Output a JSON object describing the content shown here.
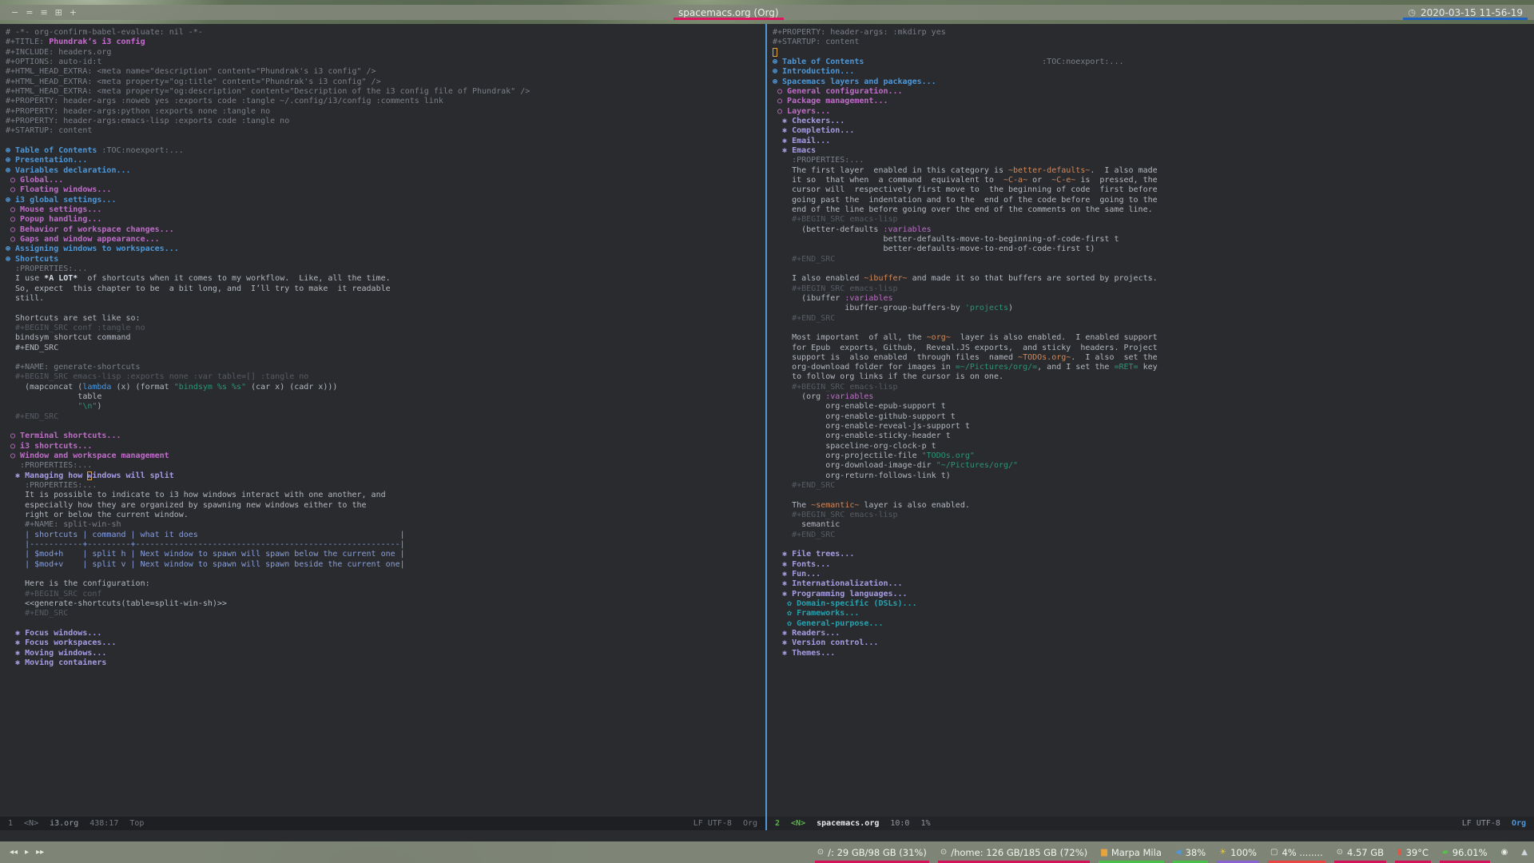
{
  "colors": {
    "background": "#292b2e",
    "divider_blue": "#4f97d7",
    "title_underline": "#dc1560",
    "clock_underline": "#1d62c4",
    "heading1": "#4f97d7",
    "heading2": "#bc6ec5",
    "heading3": "#a79ce0",
    "heading4": "#2aa1ae",
    "string_green": "#2d9574",
    "inline_code_orange": "#d3885a",
    "cursor_outline": "#e2a33c"
  },
  "top_bar": {
    "window_buttons": [
      {
        "name": "layout-dash-icon",
        "glyph": "−"
      },
      {
        "name": "layout-stacked-icon",
        "glyph": "="
      },
      {
        "name": "layout-tabbed-icon",
        "glyph": "≡"
      },
      {
        "name": "layout-grid-icon",
        "glyph": "⊞"
      },
      {
        "name": "new-workspace-icon",
        "glyph": "+"
      }
    ],
    "title": "spacemacs.org (Org)",
    "clock_icon": "◷",
    "clock": "2020-03-15 11-56-19"
  },
  "left_pane": {
    "lines": [
      [
        [
          "m",
          "# -*- org-confirm-babel-evaluate: nil -*-"
        ]
      ],
      [
        [
          "m",
          "#+TITLE: "
        ],
        [
          "ti",
          "Phundrak’s i3 config"
        ]
      ],
      [
        [
          "m",
          "#+INCLUDE: headers.org"
        ]
      ],
      [
        [
          "m",
          "#+OPTIONS: auto-id:t"
        ]
      ],
      [
        [
          "m",
          "#+HTML_HEAD_EXTRA: <meta name=\"description\" content=\"Phundrak's i3 config\" />"
        ]
      ],
      [
        [
          "m",
          "#+HTML_HEAD_EXTRA: <meta property=\"og:title\" content=\"Phundrak's i3 config\" />"
        ]
      ],
      [
        [
          "m",
          "#+HTML_HEAD_EXTRA: <meta property=\"og:description\" content=\"Description of the i3 config file of Phundrak\" />"
        ]
      ],
      [
        [
          "m",
          "#+PROPERTY: header-args :noweb yes :exports code :tangle ~/.config/i3/config :comments link"
        ]
      ],
      [
        [
          "m",
          "#+PROPERTY: header-args:python :exports none :tangle no"
        ]
      ],
      [
        [
          "m",
          "#+PROPERTY: header-args:emacs-lisp :exports code :tangle no"
        ]
      ],
      [
        [
          "m",
          "#+STARTUP: content"
        ]
      ],
      [],
      [
        [
          "h1",
          "⊛ Table of Contents "
        ],
        [
          "tg",
          ":TOC:noexport:..."
        ]
      ],
      [
        [
          "h1",
          "⊛ Presentation..."
        ]
      ],
      [
        [
          "h1",
          "⊛ Variables declaration..."
        ]
      ],
      [
        [
          "h2",
          " ○ Global..."
        ]
      ],
      [
        [
          "h2",
          " ○ Floating windows..."
        ]
      ],
      [
        [
          "h1",
          "⊛ i3 global settings..."
        ]
      ],
      [
        [
          "h2",
          " ○ Mouse settings..."
        ]
      ],
      [
        [
          "h2",
          " ○ Popup handling..."
        ]
      ],
      [
        [
          "h2",
          " ○ Behavior of workspace changes..."
        ]
      ],
      [
        [
          "h2",
          " ○ Gaps and window appearance..."
        ]
      ],
      [
        [
          "h1",
          "⊛ Assigning windows to workspaces..."
        ]
      ],
      [
        [
          "h1",
          "⊛ Shortcuts"
        ]
      ],
      [
        [
          "m",
          "  :PROPERTIES:..."
        ]
      ],
      [
        [
          "t",
          "  I use "
        ],
        [
          "b",
          "*A LOT*"
        ],
        [
          "t",
          "  of shortcuts when it comes to my workflow.  Like, all the time."
        ]
      ],
      [
        [
          "t",
          "  So, expect  this chapter to be  a bit long, and  I’ll try to make  it readable"
        ]
      ],
      [
        [
          "t",
          "  still."
        ]
      ],
      [],
      [
        [
          "t",
          "  Shortcuts are set like so:"
        ]
      ],
      [
        [
          "d",
          "  #+BEGIN_SRC conf :tangle no"
        ]
      ],
      [
        [
          "c",
          "  bindsym shortcut command"
        ]
      ],
      [
        [
          "c",
          "  #+END_SRC"
        ]
      ],
      [],
      [
        [
          "m",
          "  #+NAME: generate-shortcuts"
        ]
      ],
      [
        [
          "d",
          "  #+BEGIN_SRC emacs-lisp :exports none :var table=[] :tangle no"
        ]
      ],
      [
        [
          "c",
          "    (mapconcat ("
        ],
        [
          "k",
          "lambda"
        ],
        [
          "c",
          " (x) (format "
        ],
        [
          "s",
          "\"bindsym %s %s\""
        ],
        [
          "c",
          " (car x) (cadr x)))"
        ]
      ],
      [
        [
          "c",
          "               table"
        ]
      ],
      [
        [
          "c",
          "               "
        ],
        [
          "s",
          "\"\\n\""
        ],
        [
          "c",
          ")"
        ]
      ],
      [
        [
          "d",
          "  #+END_SRC"
        ]
      ],
      [],
      [
        [
          "h2",
          " ○ Terminal shortcuts..."
        ]
      ],
      [
        [
          "h2",
          " ○ i3 shortcuts..."
        ]
      ],
      [
        [
          "h2",
          " ○ Window and workspace management"
        ]
      ],
      [
        [
          "m",
          "   :PROPERTIES:..."
        ]
      ],
      [
        [
          "h3",
          "  ✱ Managing how "
        ],
        [
          "h3cur",
          "w"
        ],
        [
          "h3",
          "indows will split"
        ]
      ],
      [
        [
          "m",
          "    :PROPERTIES:..."
        ]
      ],
      [
        [
          "t",
          "    It is possible to indicate to i3 how windows interact with one another, and"
        ]
      ],
      [
        [
          "t",
          "    especially how they are organized by spawning new windows either to the"
        ]
      ],
      [
        [
          "t",
          "    right or below the current window."
        ]
      ],
      [
        [
          "m",
          "    #+NAME: split-win-sh"
        ]
      ],
      [
        [
          "tb",
          "    | shortcuts | command | what it does                                          |"
        ]
      ],
      [
        [
          "tb",
          "    |-----------+---------+-------------------------------------------------------|"
        ]
      ],
      [
        [
          "tb",
          "    | $mod+h    | split h | Next window to spawn will spawn below the current one |"
        ]
      ],
      [
        [
          "tb",
          "    | $mod+v    | split v | Next window to spawn will spawn beside the current one|"
        ]
      ],
      [],
      [
        [
          "t",
          "    Here is the configuration:"
        ]
      ],
      [
        [
          "d",
          "    #+BEGIN_SRC conf"
        ]
      ],
      [
        [
          "c",
          "    <<generate-shortcuts(table=split-win-sh)>>"
        ]
      ],
      [
        [
          "d",
          "    #+END_SRC"
        ]
      ],
      [],
      [
        [
          "h3",
          "  ✱ Focus windows..."
        ]
      ],
      [
        [
          "h3",
          "  ✱ Focus workspaces..."
        ]
      ],
      [
        [
          "h3",
          "  ✱ Moving windows..."
        ]
      ],
      [
        [
          "h3",
          "  ✱ Moving containers"
        ]
      ]
    ],
    "modeline": {
      "window": "1",
      "state": "<N>",
      "buffer": "i3.org",
      "position": "438:17",
      "percent": "Top",
      "encoding": "LF UTF-8",
      "mode": "Org"
    }
  },
  "right_pane": {
    "lines": [
      [
        [
          "m",
          "#+PROPERTY: header-args: :mkdirp yes"
        ]
      ],
      [
        [
          "m",
          "#+STARTUP: content"
        ]
      ],
      [
        [
          "cur",
          " "
        ]
      ],
      [
        [
          "h1",
          "⊛ Table of Contents"
        ],
        [
          "tg",
          "                                     :TOC:noexport:..."
        ]
      ],
      [
        [
          "h1",
          "⊛ Introduction..."
        ]
      ],
      [
        [
          "h1",
          "⊛ Spacemacs layers and packages..."
        ]
      ],
      [
        [
          "h2",
          " ○ General configuration..."
        ]
      ],
      [
        [
          "h2",
          " ○ Package management..."
        ]
      ],
      [
        [
          "h2",
          " ○ Layers..."
        ]
      ],
      [
        [
          "h3",
          "  ✱ Checkers..."
        ]
      ],
      [
        [
          "h3",
          "  ✱ Completion..."
        ]
      ],
      [
        [
          "h3",
          "  ✱ Email..."
        ]
      ],
      [
        [
          "h3",
          "  ✱ Emacs"
        ]
      ],
      [
        [
          "m",
          "    :PROPERTIES:..."
        ]
      ],
      [
        [
          "t",
          "    The first layer  enabled in this category is "
        ],
        [
          "o",
          "~better-defaults~"
        ],
        [
          "t",
          ".  I also made"
        ]
      ],
      [
        [
          "t",
          "    it so  that when  a command  equivalent to  "
        ],
        [
          "o",
          "~C-a~"
        ],
        [
          "t",
          " or  "
        ],
        [
          "o",
          "~C-e~"
        ],
        [
          "t",
          " is  pressed, the"
        ]
      ],
      [
        [
          "t",
          "    cursor will  respectively first move to  the beginning of code  first before"
        ]
      ],
      [
        [
          "t",
          "    going past the  indentation and to the  end of the code before  going to the"
        ]
      ],
      [
        [
          "t",
          "    end of the line before going over the end of the comments on the same line."
        ]
      ],
      [
        [
          "d",
          "    #+BEGIN_SRC emacs-lisp"
        ]
      ],
      [
        [
          "c",
          "      (better-defaults "
        ],
        [
          "va",
          ":variables"
        ]
      ],
      [
        [
          "c",
          "                       better-defaults-move-to-beginning-of-code-first t"
        ]
      ],
      [
        [
          "c",
          "                       better-defaults-move-to-end-of-code-first t)"
        ]
      ],
      [
        [
          "d",
          "    #+END_SRC"
        ]
      ],
      [],
      [
        [
          "t",
          "    I also enabled "
        ],
        [
          "o",
          "~ibuffer~"
        ],
        [
          "t",
          " and made it so that buffers are sorted by projects."
        ]
      ],
      [
        [
          "d",
          "    #+BEGIN_SRC emacs-lisp"
        ]
      ],
      [
        [
          "c",
          "      (ibuffer "
        ],
        [
          "va",
          ":variables"
        ]
      ],
      [
        [
          "c",
          "               ibuffer-group-buffers-by "
        ],
        [
          "s",
          "'projects"
        ],
        [
          "c",
          ")"
        ]
      ],
      [
        [
          "d",
          "    #+END_SRC"
        ]
      ],
      [],
      [
        [
          "t",
          "    Most important  of all, the "
        ],
        [
          "o",
          "~org~"
        ],
        [
          "t",
          "  layer is also enabled.  I enabled support"
        ]
      ],
      [
        [
          "t",
          "    for Epub  exports, Github,  Reveal.JS exports,  and sticky  headers. Project"
        ]
      ],
      [
        [
          "t",
          "    support is  also enabled  through files  named "
        ],
        [
          "o",
          "~TODOs.org~"
        ],
        [
          "t",
          ".  I also  set the"
        ]
      ],
      [
        [
          "t",
          "    org-download folder for images in "
        ],
        [
          "v",
          "=~/Pictures/org/="
        ],
        [
          "t",
          ", and I set the "
        ],
        [
          "v",
          "=RET="
        ],
        [
          "t",
          " key"
        ]
      ],
      [
        [
          "t",
          "    to follow org links if the cursor is on one."
        ]
      ],
      [
        [
          "d",
          "    #+BEGIN_SRC emacs-lisp"
        ]
      ],
      [
        [
          "c",
          "      (org "
        ],
        [
          "va",
          ":variables"
        ]
      ],
      [
        [
          "c",
          "           org-enable-epub-support t"
        ]
      ],
      [
        [
          "c",
          "           org-enable-github-support t"
        ]
      ],
      [
        [
          "c",
          "           org-enable-reveal-js-support t"
        ]
      ],
      [
        [
          "c",
          "           org-enable-sticky-header t"
        ]
      ],
      [
        [
          "c",
          "           spaceline-org-clock-p t"
        ]
      ],
      [
        [
          "c",
          "           org-projectile-file "
        ],
        [
          "s",
          "\"TODOs.org\""
        ]
      ],
      [
        [
          "c",
          "           org-download-image-dir "
        ],
        [
          "s",
          "\"~/Pictures/org/\""
        ]
      ],
      [
        [
          "c",
          "           org-return-follows-link t)"
        ]
      ],
      [
        [
          "d",
          "    #+END_SRC"
        ]
      ],
      [],
      [
        [
          "t",
          "    The "
        ],
        [
          "o",
          "~semantic~"
        ],
        [
          "t",
          " layer is also enabled."
        ]
      ],
      [
        [
          "d",
          "    #+BEGIN_SRC emacs-lisp"
        ]
      ],
      [
        [
          "c",
          "      semantic"
        ]
      ],
      [
        [
          "d",
          "    #+END_SRC"
        ]
      ],
      [],
      [
        [
          "h3",
          "  ✱ File trees..."
        ]
      ],
      [
        [
          "h3",
          "  ✱ Fonts..."
        ]
      ],
      [
        [
          "h3",
          "  ✱ Fun..."
        ]
      ],
      [
        [
          "h3",
          "  ✱ Internationalization..."
        ]
      ],
      [
        [
          "h3",
          "  ✱ Programming languages..."
        ]
      ],
      [
        [
          "h4",
          "   ✿ Domain-specific (DSLs)..."
        ]
      ],
      [
        [
          "h4",
          "   ✿ Frameworks..."
        ]
      ],
      [
        [
          "h4",
          "   ✿ General-purpose..."
        ]
      ],
      [
        [
          "h3",
          "  ✱ Readers..."
        ]
      ],
      [
        [
          "h3",
          "  ✱ Version control..."
        ]
      ],
      [
        [
          "h3",
          "  ✱ Themes..."
        ]
      ]
    ],
    "modeline": {
      "window": "2",
      "state": "<N>",
      "buffer": "spacemacs.org",
      "position": "10:0",
      "percent": "1%",
      "encoding": "LF UTF-8",
      "mode": "Org"
    }
  },
  "bottom_bar": {
    "player_buttons": [
      {
        "name": "previous-track-icon",
        "glyph": "◂◂"
      },
      {
        "name": "play-icon",
        "glyph": "▸"
      },
      {
        "name": "next-track-icon",
        "glyph": "▸▸"
      }
    ],
    "modules": [
      {
        "name": "disk-root",
        "icon": "disk-icon",
        "glyph": "⊙",
        "icon_color": "#dfe3da",
        "text": "/: 29 GB/98 GB (31%)",
        "underline": "#d4145a"
      },
      {
        "name": "disk-home",
        "icon": "disk-icon",
        "glyph": "⊙",
        "icon_color": "#dfe3da",
        "text": "/home: 126 GB/185 GB (72%)",
        "underline": "#d4145a"
      },
      {
        "name": "now-playing",
        "icon": "music-chart-icon",
        "glyph": "▆",
        "icon_color": "#e8a33d",
        "text": "Marpa Mila",
        "underline": "#49c04a"
      },
      {
        "name": "volume",
        "icon": "speaker-icon",
        "glyph": "◀",
        "icon_color": "#4f97d7",
        "text": "38%",
        "underline": "#49c04a"
      },
      {
        "name": "brightness",
        "icon": "sun-icon",
        "glyph": "☀",
        "icon_color": "#e8c545",
        "text": "100%",
        "underline": "#8a63d2"
      },
      {
        "name": "cpu",
        "icon": "cpu-icon",
        "glyph": "▢",
        "icon_color": "#dfe3da",
        "text": "4% ........",
        "underline": "#e84545"
      },
      {
        "name": "memory",
        "icon": "memory-icon",
        "glyph": "⊙",
        "icon_color": "#dfe3da",
        "text": "4.57 GB",
        "underline": "#d4145a"
      },
      {
        "name": "temperature",
        "icon": "thermometer-icon",
        "glyph": "▮",
        "icon_color": "#e05545",
        "text": "39°C",
        "underline": "#d4145a"
      },
      {
        "name": "battery",
        "icon": "battery-icon",
        "glyph": "▰",
        "icon_color": "#57c04b",
        "text": "96.01%",
        "underline": "#d4145a"
      },
      {
        "name": "discord",
        "icon": "discord-icon",
        "glyph": "◉",
        "icon_color": "#e8eae4",
        "text": "",
        "underline": ""
      },
      {
        "name": "wifi",
        "icon": "wifi-icon",
        "glyph": "▲",
        "icon_color": "#cfd6dc",
        "text": "",
        "underline": ""
      }
    ]
  }
}
